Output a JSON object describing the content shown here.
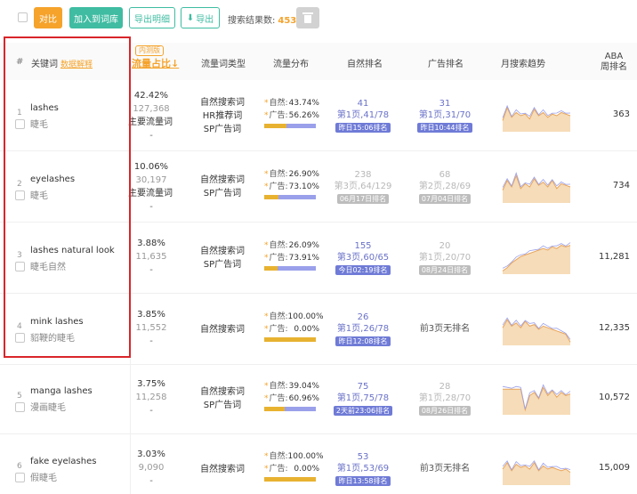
{
  "toolbar": {
    "compare": "对比",
    "add_to_lexicon": "加入到词库",
    "export_detail": "导出明细",
    "export": "导出",
    "result_label": "搜索结果数:",
    "result_count": "453"
  },
  "header": {
    "hash": "#",
    "keyword": "关键词",
    "data_explain": "数据解释",
    "beta": "内测版",
    "traffic_share": "流量占比↓",
    "keyword_type": "流量词类型",
    "traffic_dist": "流量分布",
    "natural_rank": "自然排名",
    "ad_rank": "广告排名",
    "monthly_trend": "月搜索趋势",
    "aba_line1": "ABA",
    "aba_line2": "周排名"
  },
  "labels": {
    "natural": "自然:",
    "ad": "广告:"
  },
  "rows": [
    {
      "index": "1",
      "kw_en": "lashes",
      "kw_cn": "睫毛",
      "share": "42.42%",
      "volume": "127,368",
      "main": "主要流量词",
      "dash": "-",
      "types": [
        "自然搜索词",
        "HR推荐词",
        "SP广告词"
      ],
      "natural_pct": "43.74%",
      "ad_pct": "56.26%",
      "natural_frac": 0.4374,
      "nat_num": "41",
      "nat_page": "第1页,41/78",
      "nat_badge": "昨日15:06排名",
      "nat_grey": false,
      "ad_num": "31",
      "ad_page": "第1页,31/70",
      "ad_badge": "昨日10:44排名",
      "ad_grey": false,
      "ad_none": "",
      "aba": "363",
      "trend": [
        0.35,
        0.75,
        0.45,
        0.6,
        0.5,
        0.55,
        0.4,
        0.7,
        0.5,
        0.6,
        0.45,
        0.55,
        0.5,
        0.6,
        0.55,
        0.5
      ]
    },
    {
      "index": "2",
      "kw_en": "eyelashes",
      "kw_cn": "睫毛",
      "share": "10.06%",
      "volume": "30,197",
      "main": "主要流量词",
      "dash": "-",
      "types": [
        "自然搜索词",
        "SP广告词"
      ],
      "natural_pct": "26.90%",
      "ad_pct": "73.10%",
      "natural_frac": 0.269,
      "nat_num": "238",
      "nat_page": "第3页,64/129",
      "nat_badge": "06月17日排名",
      "nat_grey": true,
      "ad_num": "68",
      "ad_page": "第2页,28/69",
      "ad_badge": "07月04日排名",
      "ad_grey": true,
      "ad_none": "",
      "aba": "734",
      "trend": [
        0.4,
        0.7,
        0.5,
        0.85,
        0.45,
        0.6,
        0.5,
        0.75,
        0.55,
        0.65,
        0.5,
        0.7,
        0.45,
        0.6,
        0.55,
        0.5
      ]
    },
    {
      "index": "3",
      "kw_en": "lashes natural look",
      "kw_cn": "睫毛自然",
      "share": "3.88%",
      "volume": "11,635",
      "main": "",
      "dash": "-",
      "types": [
        "自然搜索词",
        "SP广告词"
      ],
      "natural_pct": "26.09%",
      "ad_pct": "73.91%",
      "natural_frac": 0.2609,
      "nat_num": "155",
      "nat_page": "第3页,60/65",
      "nat_badge": "今日02:19排名",
      "nat_grey": false,
      "ad_num": "20",
      "ad_page": "第1页,20/70",
      "ad_badge": "08月24日排名",
      "ad_grey": true,
      "ad_none": "",
      "aba": "11,281",
      "trend": [
        0.1,
        0.2,
        0.35,
        0.45,
        0.55,
        0.6,
        0.65,
        0.7,
        0.75,
        0.8,
        0.75,
        0.85,
        0.8,
        0.9,
        0.85,
        0.9
      ]
    },
    {
      "index": "4",
      "kw_en": "mink lashes",
      "kw_cn": "貂鞭的睫毛",
      "share": "3.85%",
      "volume": "11,552",
      "main": "",
      "dash": "-",
      "types": [
        "自然搜索词"
      ],
      "natural_pct": "100.00%",
      "ad_pct": "0.00%",
      "natural_frac": 1.0,
      "nat_num": "26",
      "nat_page": "第1页,26/78",
      "nat_badge": "昨日12:08排名",
      "nat_grey": false,
      "ad_num": "",
      "ad_page": "",
      "ad_badge": "",
      "ad_grey": false,
      "ad_none": "前3页无排名",
      "aba": "12,335",
      "trend": [
        0.55,
        0.8,
        0.6,
        0.7,
        0.55,
        0.75,
        0.6,
        0.65,
        0.5,
        0.6,
        0.55,
        0.5,
        0.45,
        0.4,
        0.35,
        0.1
      ]
    },
    {
      "index": "5",
      "kw_en": "manga lashes",
      "kw_cn": "漫画睫毛",
      "share": "3.75%",
      "volume": "11,258",
      "main": "",
      "dash": "-",
      "types": [
        "自然搜索词",
        "SP广告词"
      ],
      "natural_pct": "39.04%",
      "ad_pct": "60.96%",
      "natural_frac": 0.3904,
      "nat_num": "75",
      "nat_page": "第1页,75/78",
      "nat_badge": "2天前23:06排名",
      "nat_grey": false,
      "ad_num": "28",
      "ad_page": "第1页,28/70",
      "ad_badge": "08月26日排名",
      "ad_grey": true,
      "ad_none": "",
      "aba": "10,572",
      "trend": [
        0.8,
        0.8,
        0.8,
        0.8,
        0.8,
        0.15,
        0.6,
        0.7,
        0.5,
        0.85,
        0.6,
        0.75,
        0.55,
        0.7,
        0.6,
        0.65
      ]
    },
    {
      "index": "6",
      "kw_en": "fake eyelashes",
      "kw_cn": "假睫毛",
      "share": "3.03%",
      "volume": "9,090",
      "main": "",
      "dash": "-",
      "types": [
        "自然搜索词"
      ],
      "natural_pct": "100.00%",
      "ad_pct": "0.00%",
      "natural_frac": 1.0,
      "nat_num": "53",
      "nat_page": "第1页,53/69",
      "nat_badge": "昨日13:58排名",
      "nat_grey": false,
      "ad_num": "",
      "ad_page": "",
      "ad_badge": "",
      "ad_grey": false,
      "ad_none": "前3页无排名",
      "aba": "15,009",
      "trend": [
        0.5,
        0.7,
        0.45,
        0.65,
        0.55,
        0.6,
        0.5,
        0.7,
        0.45,
        0.6,
        0.5,
        0.55,
        0.5,
        0.45,
        0.5,
        0.4
      ]
    }
  ],
  "colors": {
    "orange": "#f5a32b",
    "teal": "#3fbca2",
    "purple": "#6f7bd6",
    "gold": "#e8b231",
    "highlight": "#d9262b"
  }
}
